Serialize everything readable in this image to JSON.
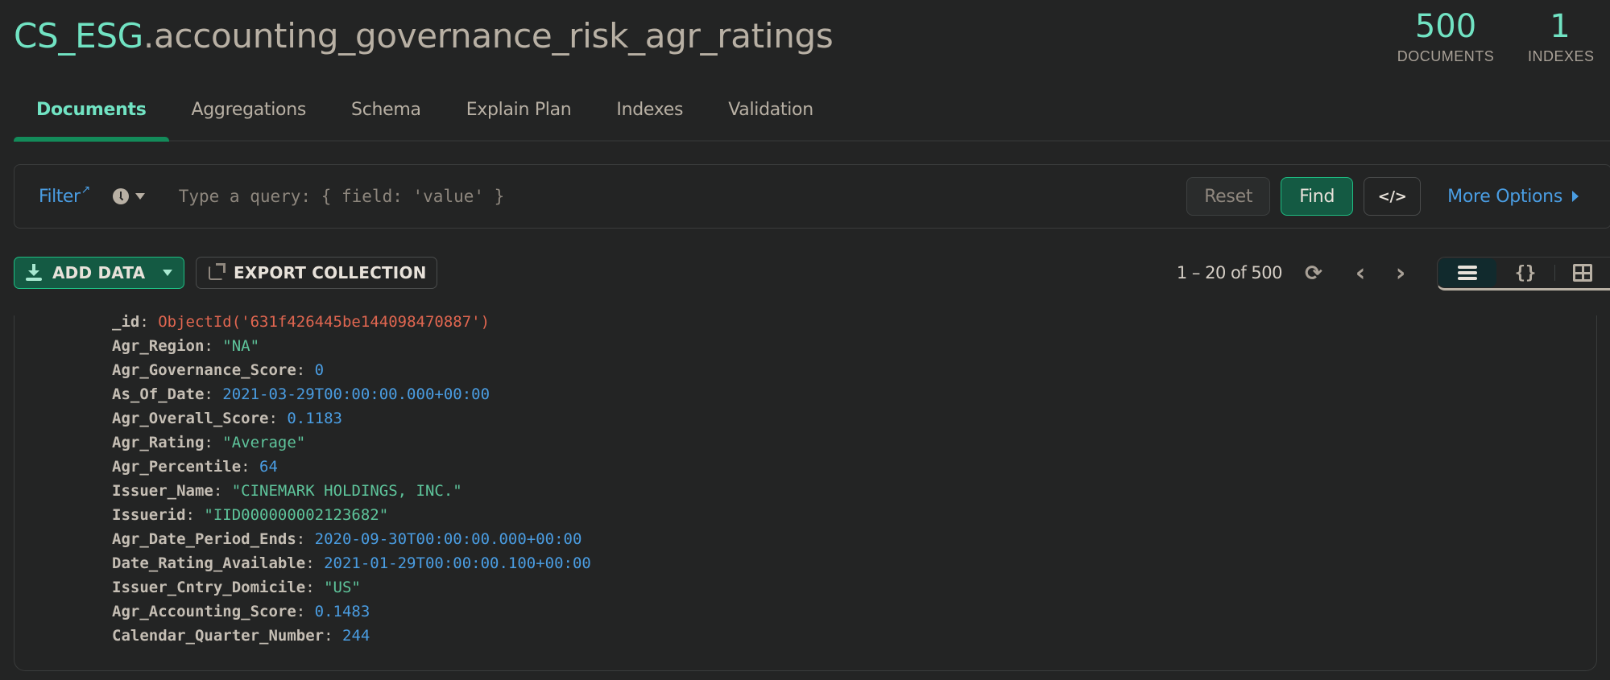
{
  "header": {
    "database": "CS_ESG",
    "collection": ".accounting_governance_risk_agr_ratings",
    "stats": {
      "documents": {
        "value": "500",
        "label": "DOCUMENTS"
      },
      "indexes": {
        "value": "1",
        "label": "INDEXES"
      }
    }
  },
  "tabs": [
    {
      "label": "Documents",
      "active": true
    },
    {
      "label": "Aggregations",
      "active": false
    },
    {
      "label": "Schema",
      "active": false
    },
    {
      "label": "Explain Plan",
      "active": false
    },
    {
      "label": "Indexes",
      "active": false
    },
    {
      "label": "Validation",
      "active": false
    }
  ],
  "filter": {
    "label": "Filter",
    "external_icon": "↗",
    "history_icon": "clock-icon",
    "query_value": "",
    "placeholder": "Type a query: { field: 'value' }",
    "reset_label": "Reset",
    "find_label": "Find",
    "code_label": "</>",
    "more_options_label": "More Options"
  },
  "toolbar": {
    "add_data_label": "ADD DATA",
    "export_label": "EXPORT COLLECTION",
    "pagination": "1 – 20 of 500",
    "refresh_icon": "⟳",
    "prev_icon": "‹",
    "next_icon": "›",
    "views": {
      "list": "list-view",
      "json": "{}",
      "table": "table-view",
      "active": "list"
    }
  },
  "document": {
    "fields": [
      {
        "key": "_id",
        "value": "ObjectId('631f426445be144098470887')",
        "type": "oid"
      },
      {
        "key": "Agr_Region",
        "value": "\"NA\"",
        "type": "str"
      },
      {
        "key": "Agr_Governance_Score",
        "value": "0",
        "type": "num"
      },
      {
        "key": "As_Of_Date",
        "value": "2021-03-29T00:00:00.000+00:00",
        "type": "date"
      },
      {
        "key": "Agr_Overall_Score",
        "value": "0.1183",
        "type": "num"
      },
      {
        "key": "Agr_Rating",
        "value": "\"Average\"",
        "type": "str"
      },
      {
        "key": "Agr_Percentile",
        "value": "64",
        "type": "num"
      },
      {
        "key": "Issuer_Name",
        "value": "\"CINEMARK HOLDINGS, INC.\"",
        "type": "str"
      },
      {
        "key": "Issuerid",
        "value": "\"IID000000002123682\"",
        "type": "str"
      },
      {
        "key": "Agr_Date_Period_Ends",
        "value": "2020-09-30T00:00:00.000+00:00",
        "type": "date"
      },
      {
        "key": "Date_Rating_Available",
        "value": "2021-01-29T00:00:00.100+00:00",
        "type": "date"
      },
      {
        "key": "Issuer_Cntry_Domicile",
        "value": "\"US\"",
        "type": "str"
      },
      {
        "key": "Agr_Accounting_Score",
        "value": "0.1483",
        "type": "num"
      },
      {
        "key": "Calendar_Quarter_Number",
        "value": "244",
        "type": "num"
      }
    ]
  },
  "colors": {
    "accent_green": "#71e3c3",
    "button_green": "#145a43",
    "link_blue": "#4a9de2",
    "objectid_red": "#e06650",
    "string_green": "#5ec49b",
    "background": "#232424"
  }
}
